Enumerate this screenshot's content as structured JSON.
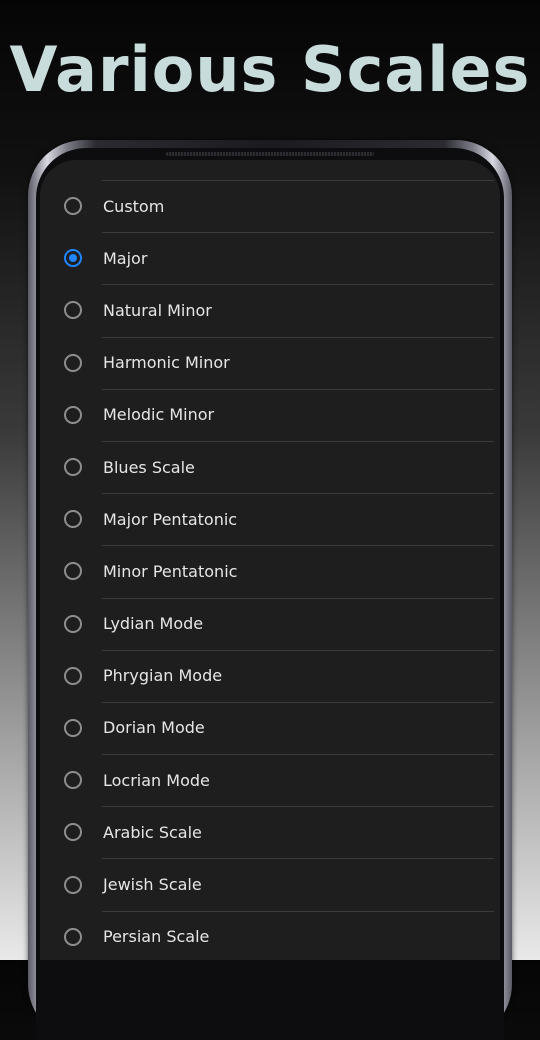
{
  "hero": {
    "title": "Various Scales"
  },
  "colors": {
    "accent": "#1f86ff",
    "screen_bg": "#1e1e1e",
    "text": "#e6e6e6",
    "radio_border": "#8e8e8e",
    "title_color": "#c9dcdc"
  },
  "scales": [
    {
      "label": "Custom",
      "selected": false
    },
    {
      "label": "Major",
      "selected": true
    },
    {
      "label": "Natural Minor",
      "selected": false
    },
    {
      "label": "Harmonic Minor",
      "selected": false
    },
    {
      "label": "Melodic Minor",
      "selected": false
    },
    {
      "label": "Blues Scale",
      "selected": false
    },
    {
      "label": "Major Pentatonic",
      "selected": false
    },
    {
      "label": "Minor Pentatonic",
      "selected": false
    },
    {
      "label": "Lydian Mode",
      "selected": false
    },
    {
      "label": "Phrygian Mode",
      "selected": false
    },
    {
      "label": "Dorian Mode",
      "selected": false
    },
    {
      "label": "Locrian Mode",
      "selected": false
    },
    {
      "label": "Arabic Scale",
      "selected": false
    },
    {
      "label": "Jewish Scale",
      "selected": false
    },
    {
      "label": "Persian Scale",
      "selected": false
    }
  ]
}
